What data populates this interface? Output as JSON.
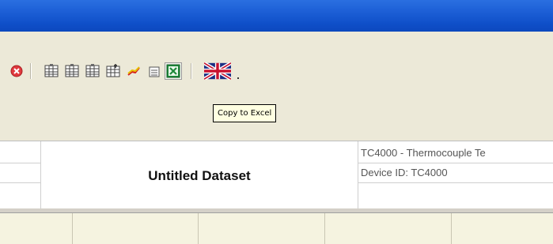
{
  "toolbar": {
    "buttons": [
      {
        "name": "stop-icon"
      },
      {
        "name": "table-1-icon"
      },
      {
        "name": "table-2-icon"
      },
      {
        "name": "table-3-icon"
      },
      {
        "name": "table-4-icon"
      },
      {
        "name": "chart-line-icon"
      },
      {
        "name": "calculator-icon"
      },
      {
        "name": "excel-icon"
      },
      {
        "name": "uk-flag-icon"
      },
      {
        "name": "chevron-down-icon"
      }
    ],
    "tooltip": "Copy to Excel"
  },
  "dataset": {
    "title": "Untitled Dataset",
    "model_line": "TC4000 - Thermocouple Te",
    "device_id": "Device ID: TC4000"
  },
  "colors": {
    "titlebar": "#1f62d8",
    "toolbar_bg": "#ece9d8",
    "tooltip_bg": "#ffffe1"
  }
}
